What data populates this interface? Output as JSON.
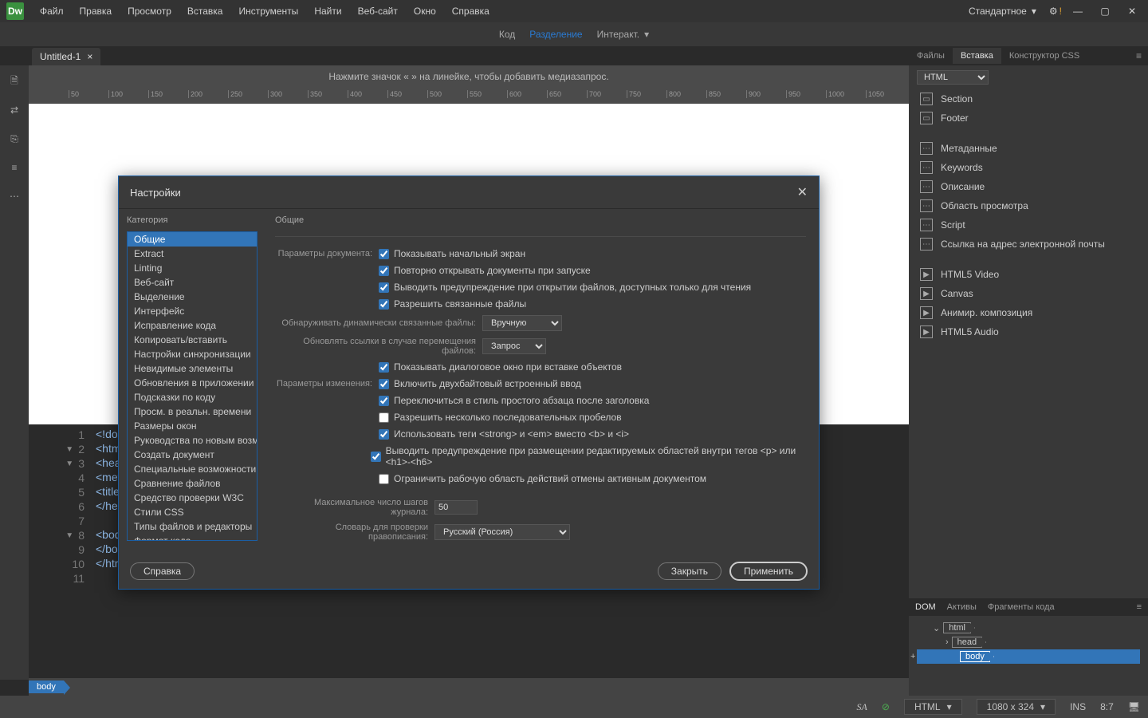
{
  "menubar": {
    "items": [
      "Файл",
      "Правка",
      "Просмотр",
      "Вставка",
      "Инструменты",
      "Найти",
      "Веб-сайт",
      "Окно",
      "Справка"
    ],
    "workspace": "Стандартное"
  },
  "viewbar": {
    "code": "Код",
    "split": "Разделение",
    "interact": "Интеракт."
  },
  "tab": {
    "name": "Untitled-1"
  },
  "ruler_hint": "Нажмите значок «     » на линейке, чтобы добавить медиазапрос.",
  "code_lines": [
    "<!doctype",
    "<html>",
    "<head>",
    "<meta",
    "<title",
    "</head",
    "",
    "<body>",
    "</body",
    "</html",
    ""
  ],
  "tagpath": "body",
  "status": {
    "lang": "HTML",
    "dims": "1080 x 324",
    "ins": "INS",
    "pos": "8:7"
  },
  "right": {
    "tabs": [
      "Файлы",
      "Вставка",
      "Конструктор CSS"
    ],
    "dropdown": "HTML",
    "items1": [
      "Section",
      "Footer"
    ],
    "items2": [
      "Метаданные",
      "Keywords",
      "Описание",
      "Область просмотра",
      "Script",
      "Ссылка на адрес электронной почты"
    ],
    "items3": [
      "HTML5 Video",
      "Canvas",
      "Анимир. композиция",
      "HTML5 Audio"
    ],
    "dom_tabs": [
      "DOM",
      "Активы",
      "Фрагменты кода"
    ],
    "dom_nodes": [
      "html",
      "head",
      "body"
    ]
  },
  "dialog": {
    "title": "Настройки",
    "cat_header": "Категория",
    "content_header": "Общие",
    "categories": [
      "Общие",
      "Extract",
      "Linting",
      "Веб-сайт",
      "Выделение",
      "Интерфейс",
      "Исправление кода",
      "Копировать/вставить",
      "Настройки синхронизации",
      "Невидимые элементы",
      "Обновления в приложении",
      "Подсказки по коду",
      "Просм. в реальн. времени",
      "Размеры окон",
      "Руководства по новым возм",
      "Создать документ",
      "Специальные возможности",
      "Сравнение файлов",
      "Средство проверки W3C",
      "Стили CSS",
      "Типы файлов и редакторы",
      "Формат кода"
    ],
    "group_doc": "Параметры документа:",
    "group_edit": "Параметры изменения:",
    "cb1": "Показывать начальный экран",
    "cb2": "Повторно открывать документы при запуске",
    "cb3": "Выводить предупреждение при открытии файлов, доступных только для чтения",
    "cb4": "Разрешить связанные файлы",
    "sel1_label": "Обнаруживать динамически связанные файлы:",
    "sel1_value": "Вручную",
    "sel2_label": "Обновлять ссылки в случае перемещения файлов:",
    "sel2_value": "Запрос",
    "cb5": "Показывать диалоговое окно при вставке объектов",
    "cb6": "Включить двухбайтовый встроенный ввод",
    "cb7": "Переключиться в стиль простого абзаца после заголовка",
    "cb8": "Разрешить несколько последовательных пробелов",
    "cb9": "Использовать теги <strong> и <em> вместо <b> и <i>",
    "cb10": "Выводить предупреждение при размещении редактируемых областей внутри тегов <p> или <h1>-<h6>",
    "cb11": "Ограничить рабочую область действий отмены активным документом",
    "steps_label": "Максимальное число шагов журнала:",
    "steps_value": "50",
    "dict_label": "Словарь для проверки правописания:",
    "dict_value": "Русский (Россия)",
    "btn_help": "Справка",
    "btn_close": "Закрыть",
    "btn_apply": "Применить"
  }
}
